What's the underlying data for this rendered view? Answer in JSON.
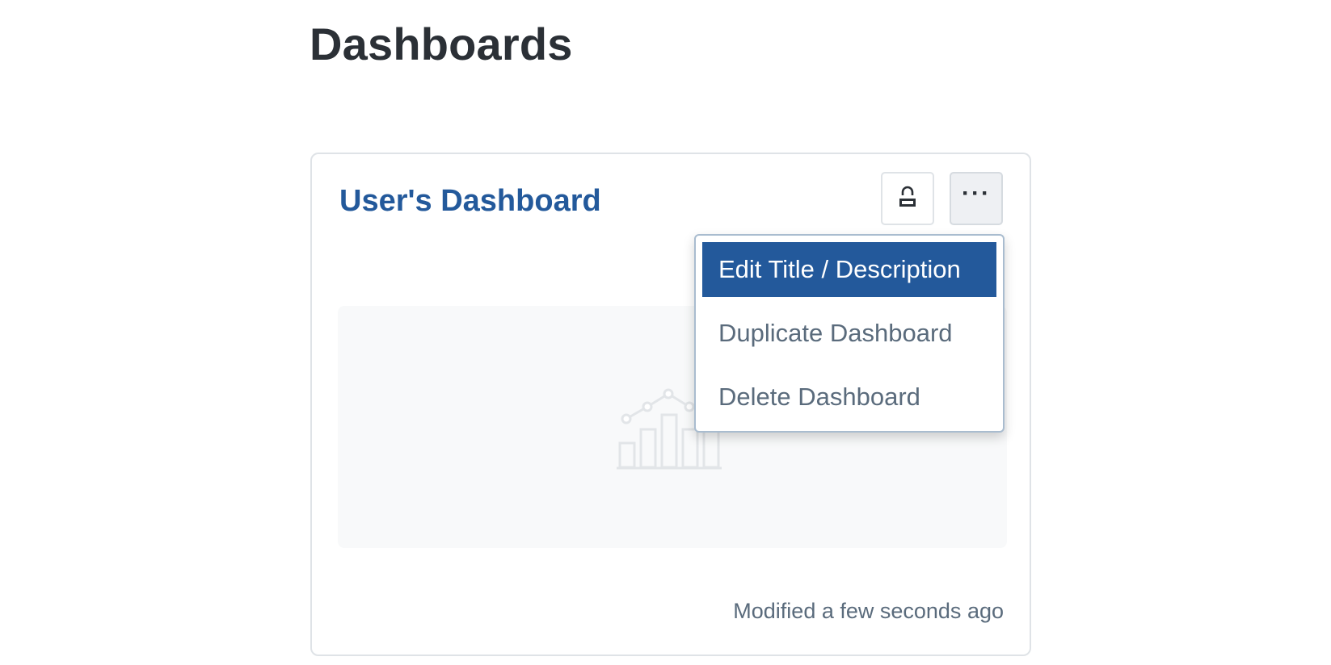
{
  "page": {
    "title": "Dashboards"
  },
  "card": {
    "title": "User's Dashboard",
    "modified": "Modified a few seconds ago",
    "lock_icon": "lock-icon",
    "more_icon": "more-horizontal-icon",
    "preview_icon": "chart-placeholder-icon"
  },
  "menu": {
    "items": [
      {
        "label": "Edit Title / Description",
        "highlighted": true
      },
      {
        "label": "Duplicate Dashboard",
        "highlighted": false
      },
      {
        "label": "Delete Dashboard",
        "highlighted": false
      }
    ]
  },
  "colors": {
    "accent": "#23599b",
    "text_dark": "#2b3036",
    "text_muted": "#5a6b7c",
    "border": "#dfe3e7"
  }
}
